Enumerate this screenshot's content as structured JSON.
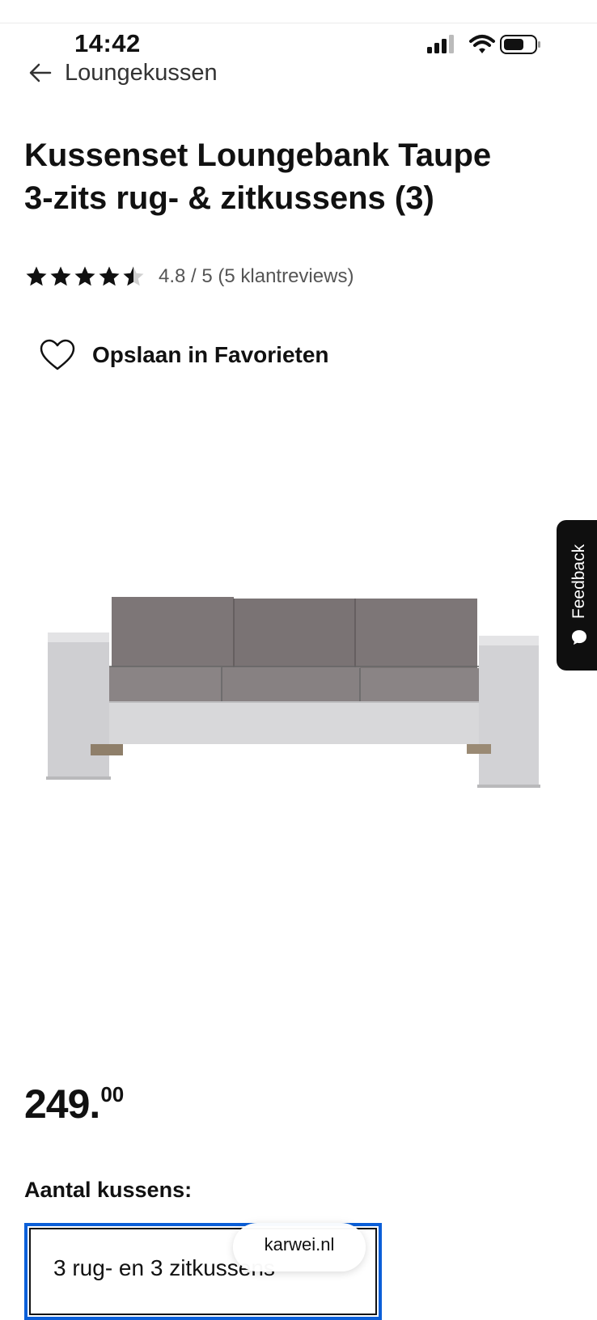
{
  "status_bar": {
    "time": "14:42"
  },
  "nav": {
    "back_label": "Loungekussen"
  },
  "product": {
    "title_line1": "Kussenset Loungebank Taupe",
    "title_line2": "3-zits rug- & zitkussens (3)",
    "rating": 4.8,
    "rating_text": "4.8 / 5 (5 klantreviews)",
    "favorite_label": "Opslaan in Favorieten",
    "price_int": "249.",
    "price_dec": "00"
  },
  "options": {
    "quantity_label": "Aantal kussens:",
    "selected_value": "3 rug- en 3 zitkussens"
  },
  "feedback": {
    "label": "Feedback"
  },
  "browser": {
    "url": "karwei.nl"
  },
  "colors": {
    "accent": "#0b5fd8",
    "text": "#111111",
    "feedback_bg": "#0f0f0f"
  }
}
